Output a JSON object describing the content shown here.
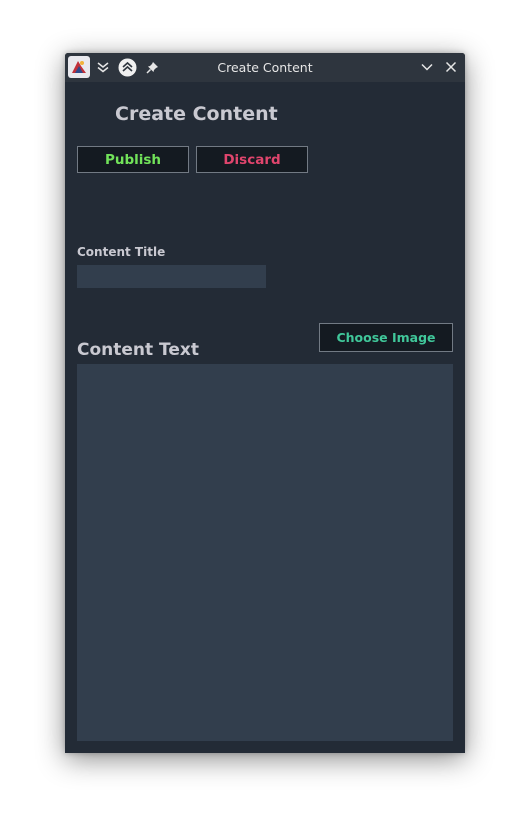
{
  "window": {
    "title": "Create Content"
  },
  "page": {
    "heading": "Create Content"
  },
  "actions": {
    "publish_label": "Publish",
    "discard_label": "Discard",
    "choose_image_label": "Choose Image"
  },
  "form": {
    "title_label": "Content Title",
    "title_value": "",
    "text_label": "Content Text",
    "text_value": ""
  },
  "colors": {
    "publish": "#72e35a",
    "discard": "#e0456d",
    "choose_image": "#40c79a",
    "field_bg": "#323e4d",
    "window_bg": "#232b36"
  },
  "icons": {
    "app": "app-logo-icon",
    "keep_below": "double-chevron-down-icon",
    "keep_above": "chevron-up-circle-icon",
    "pin": "pin-icon",
    "minimize": "chevron-down-icon",
    "close": "close-icon"
  }
}
